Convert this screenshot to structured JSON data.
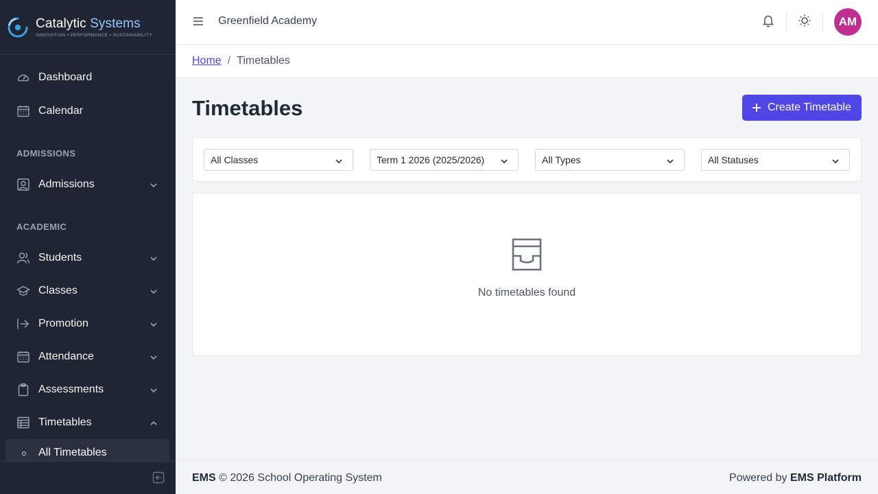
{
  "brand": {
    "name_part1": "Catalytic",
    "name_part2": "Systems",
    "tagline": "INNOVATION • PERFORMANCE • SUSTAINABILITY",
    "accent_color": "#93c5fd"
  },
  "sidebar": {
    "dashboard": "Dashboard",
    "calendar": "Calendar",
    "section_admissions": "ADMISSIONS",
    "admissions": "Admissions",
    "section_academic": "ACADEMIC",
    "students": "Students",
    "classes": "Classes",
    "promotion": "Promotion",
    "attendance": "Attendance",
    "assessments": "Assessments",
    "timetables": "Timetables",
    "all_timetables": "All Timetables"
  },
  "header": {
    "org_name": "Greenfield Academy",
    "avatar_initials": "AM",
    "avatar_color": "#be2f8f"
  },
  "breadcrumb": {
    "home": "Home",
    "separator": "/",
    "current": "Timetables"
  },
  "main": {
    "title": "Timetables",
    "create_button": "Create Timetable",
    "accent_color": "#4f46e5",
    "filters": {
      "classes": "All Classes",
      "term": "Term 1 2026 (2025/2026)",
      "types": "All Types",
      "statuses": "All Statuses"
    },
    "empty_message": "No timetables found"
  },
  "footer": {
    "brand": "EMS",
    "copyright": "© 2026 School Operating System",
    "powered_prefix": "Powered by",
    "powered_brand": "EMS Platform"
  }
}
